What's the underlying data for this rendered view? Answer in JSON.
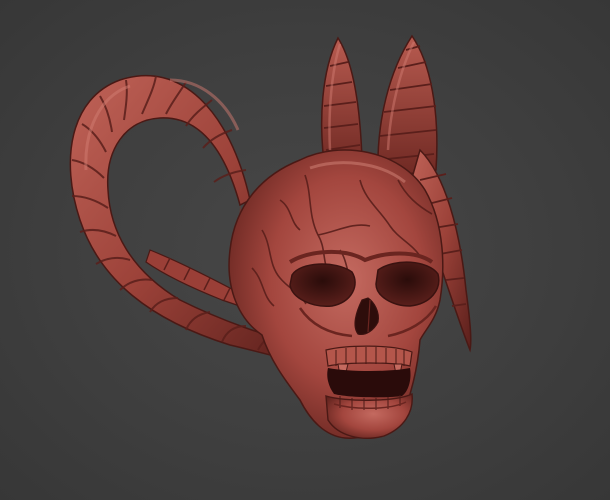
{
  "scene": {
    "subject": "demon-skull-sculpt",
    "background_color": "#404040",
    "material_colors": {
      "base": "#a3463e",
      "highlight": "#c86a5f",
      "shadow": "#5a1f1b",
      "deep_shadow": "#3a1210"
    }
  }
}
